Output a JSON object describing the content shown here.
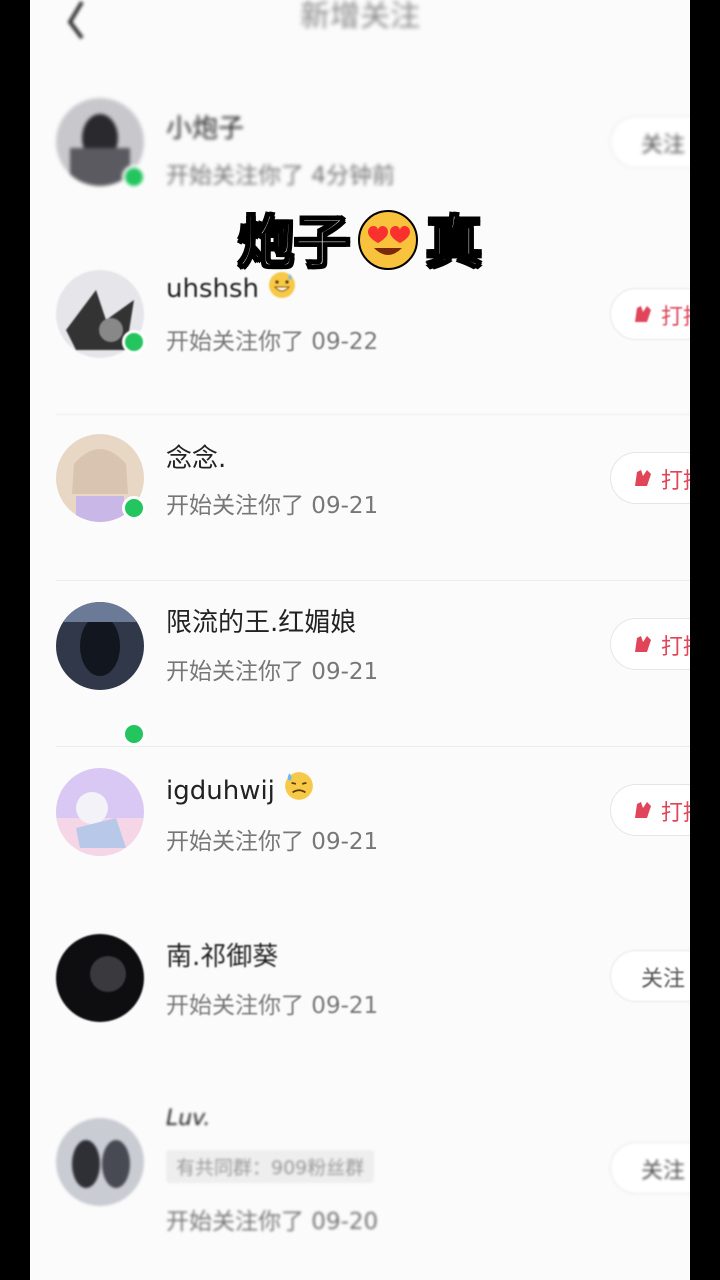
{
  "header": {
    "title": "新增关注"
  },
  "caption": {
    "left": "炮子",
    "emoji": "smiling-face-with-heart-eyes",
    "right": "真"
  },
  "follows": [
    {
      "name": "小炮子",
      "subtitle": "开始关注你了 4分钟前",
      "button": "关注",
      "online": true,
      "name_emoji": ""
    },
    {
      "name": "uhshsh",
      "subtitle": "开始关注你了 09-22",
      "button": "打招呼",
      "online": true,
      "name_emoji": "grinning-sweat-icon"
    },
    {
      "name": "念念.",
      "subtitle": "开始关注你了 09-21",
      "button": "打招呼",
      "online": true,
      "name_emoji": ""
    },
    {
      "name": "限流的王.红媚娘",
      "subtitle": "开始关注你了 09-21",
      "button": "打招呼",
      "online": true,
      "name_emoji": ""
    },
    {
      "name": "igduhwij",
      "subtitle": "开始关注你了 09-21",
      "button": "打招呼",
      "online": false,
      "name_emoji": "downcast-sweat-icon"
    },
    {
      "name": "南.祁御葵",
      "subtitle": "开始关注你了 09-21",
      "button": "关注",
      "online": false,
      "name_emoji": ""
    },
    {
      "name": "Luv.",
      "mutual": "有共同群：909粉丝群",
      "subtitle": "开始关注你了 09-20",
      "button": "关注",
      "online": false,
      "name_emoji": ""
    }
  ]
}
